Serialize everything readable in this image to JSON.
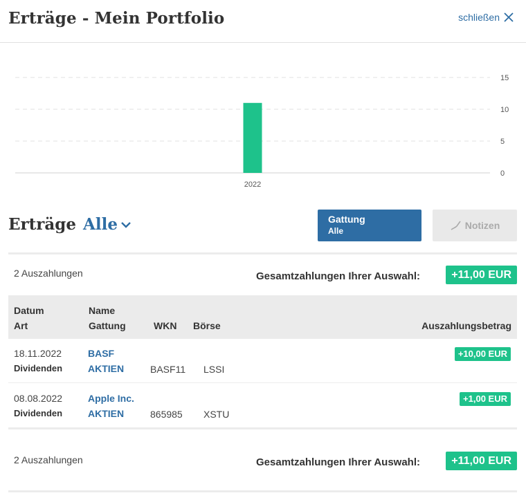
{
  "header": {
    "title": "Erträge - Mein Portfolio",
    "close_label": "schließen"
  },
  "chart_data": {
    "type": "bar",
    "categories": [
      "2022"
    ],
    "values": [
      11
    ],
    "title": "",
    "xlabel": "",
    "ylabel": "",
    "ylim": [
      0,
      15
    ],
    "yticks": [
      0,
      5,
      10,
      15
    ],
    "grid": true,
    "color": "#1ec28b"
  },
  "section": {
    "title": "Erträge",
    "filter_value": "Alle"
  },
  "toolbar": {
    "gattung_label": "Gattung",
    "gattung_value": "Alle",
    "notizen_label": "Notizen"
  },
  "summary": {
    "count": "2 Auszahlungen",
    "label": "Gesamtzahlungen Ihrer Auswahl:",
    "total": "+11,00 EUR"
  },
  "table": {
    "headers": {
      "datum": "Datum",
      "art": "Art",
      "name": "Name",
      "gattung": "Gattung",
      "wkn": "WKN",
      "boerse": "Börse",
      "betrag": "Auszahlungsbetrag"
    },
    "rows": [
      {
        "date": "18.11.2022",
        "art": "Dividenden",
        "name": "BASF",
        "gattung": "AKTIEN",
        "wkn": "BASF11",
        "boerse": "LSSI",
        "amount": "+10,00 EUR"
      },
      {
        "date": "08.08.2022",
        "art": "Dividenden",
        "name": "Apple Inc.",
        "gattung": "AKTIEN",
        "wkn": "865985",
        "boerse": "XSTU",
        "amount": "+1,00 EUR"
      }
    ]
  },
  "colors": {
    "accent": "#2e6da4",
    "positive": "#1ec28b",
    "header_bg": "#ebebeb"
  }
}
